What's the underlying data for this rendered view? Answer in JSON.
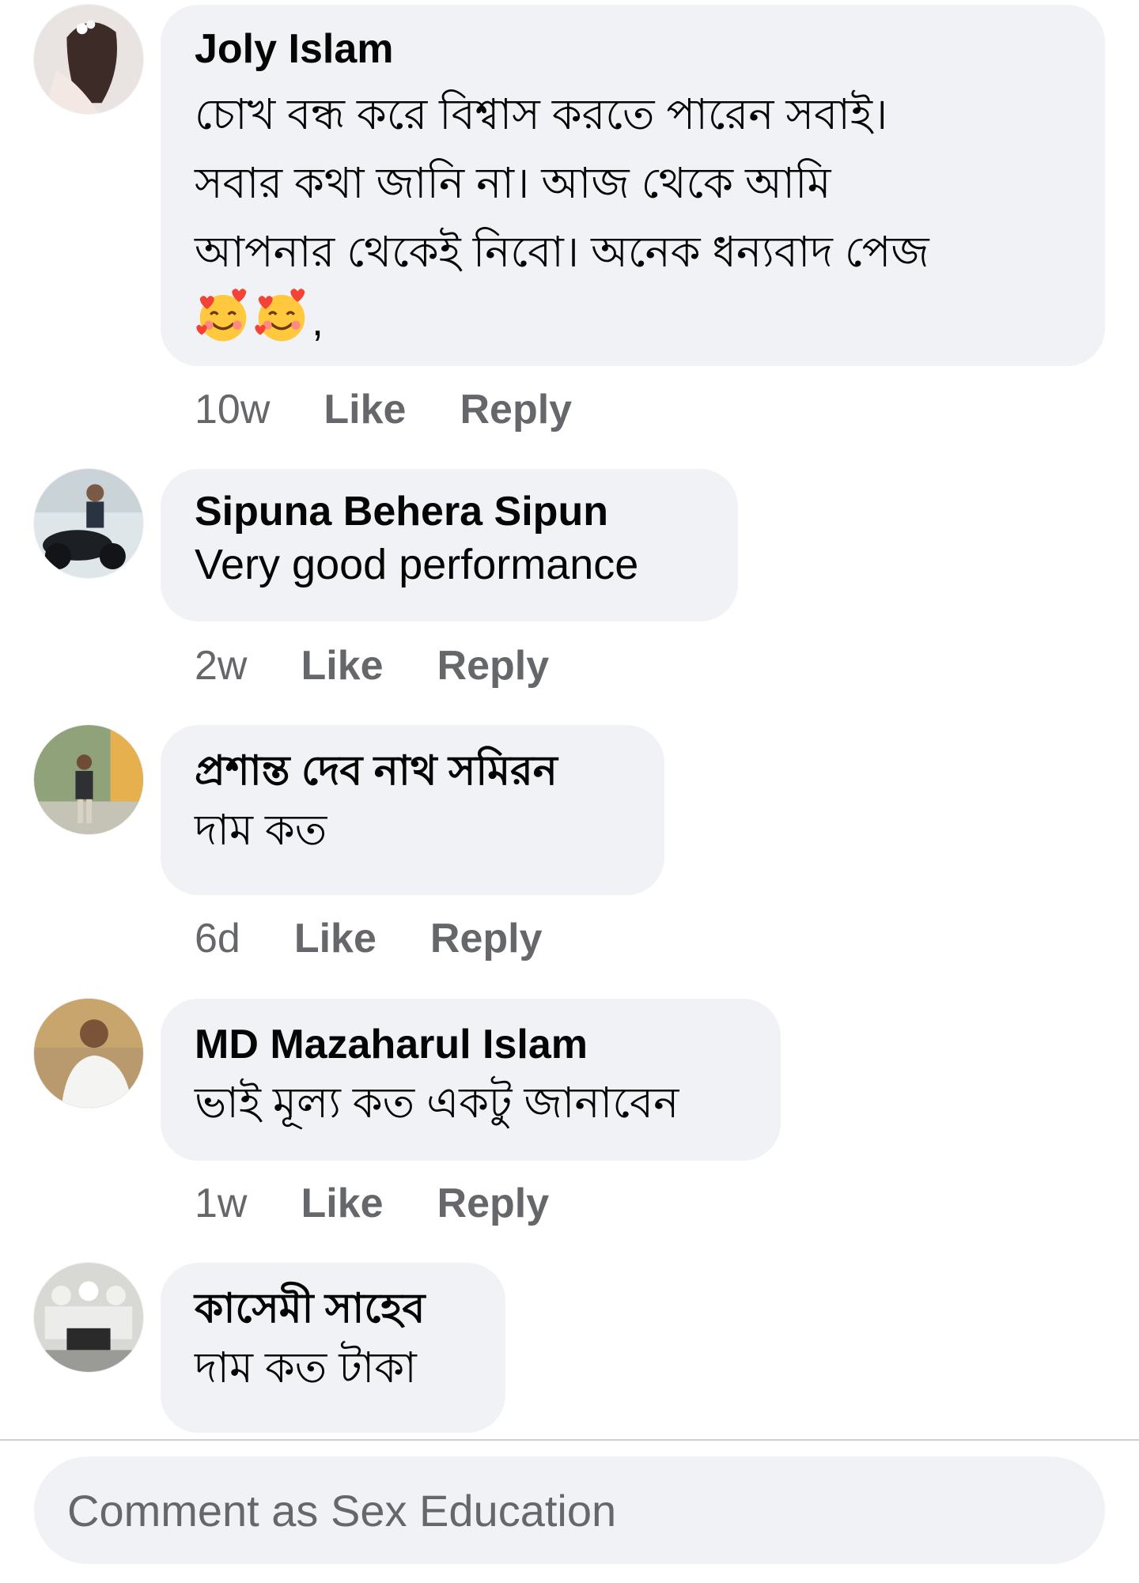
{
  "comments": [
    {
      "author": "Joly Islam",
      "lines": [
        "চোখ বন্ধ করে বিশ্বাস করতে পারেন সবাই।",
        "সবার কথা জানি না।  আজ থেকে আমি",
        "আপনার থেকেই নিবো। অনেক ধন্যবাদ পেজ"
      ],
      "emoji_tail": ",",
      "emoji_icons": [
        "smiling-face-with-hearts-icon",
        "smiling-face-with-hearts-icon"
      ],
      "time": "10w",
      "like": "Like",
      "reply": "Reply"
    },
    {
      "author": "Sipuna Behera Sipun",
      "lines": [
        "Very good performance"
      ],
      "time": "2w",
      "like": "Like",
      "reply": "Reply"
    },
    {
      "author": "প্রশান্ত দেব নাথ সমিরন",
      "lines": [
        "দাম কত"
      ],
      "time": "6d",
      "like": "Like",
      "reply": "Reply"
    },
    {
      "author": "MD Mazaharul Islam",
      "lines": [
        "ভাই মূল্য কত একটু জানাবেন"
      ],
      "time": "1w",
      "like": "Like",
      "reply": "Reply"
    },
    {
      "author": "কাসেমী সাহেব",
      "lines": [
        "দাম কত টাকা"
      ]
    }
  ],
  "composer": {
    "placeholder": "Comment as Sex Education"
  },
  "colors": {
    "bubble": "#f0f2f5",
    "meta_text": "#65676b",
    "primary_text": "#050505"
  }
}
